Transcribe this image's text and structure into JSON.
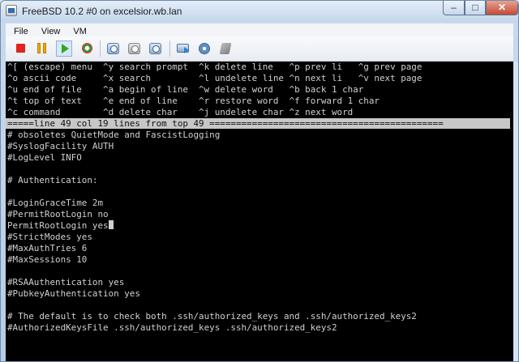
{
  "window": {
    "title": "FreeBSD 10.2 #0 on excelsior.wb.lan",
    "minimize_glyph": "–",
    "maximize_glyph": "□",
    "close_glyph": "✕"
  },
  "menubar": {
    "items": [
      "File",
      "View",
      "VM"
    ]
  },
  "toolbar": {
    "icons": [
      "stop-icon",
      "pause-icon",
      "play-icon",
      "reset-icon",
      "snapshot-icon",
      "revert-snapshot-icon",
      "snapshot-manager-icon",
      "connect-icon",
      "settings-icon",
      "tools-icon"
    ]
  },
  "terminal": {
    "menu_lines": [
      "^[ (escape) menu  ^y search prompt  ^k delete line   ^p prev li   ^g prev page",
      "^o ascii code     ^x search         ^l undelete line ^n next li   ^v next page",
      "^u end of file    ^a begin of line  ^w delete word   ^b back 1 char",
      "^t top of text    ^e end of line    ^r restore word  ^f forward 1 char",
      "^c command        ^d delete char    ^j undelete char ^z next word"
    ],
    "status_line": "=====line 49 col 19 lines from top 49 ============================================",
    "body_lines": [
      "# obsoletes QuietMode and FascistLogging",
      "#SyslogFacility AUTH",
      "#LogLevel INFO",
      "",
      "# Authentication:",
      "",
      "#LoginGraceTime 2m",
      "#PermitRootLogin no",
      "PermitRootLogin yes",
      "#StrictModes yes",
      "#MaxAuthTries 6",
      "#MaxSessions 10",
      "",
      "#RSAAuthentication yes",
      "#PubkeyAuthentication yes",
      "",
      "# The default is to check both .ssh/authorized_keys and .ssh/authorized_keys2",
      "#AuthorizedKeysFile .ssh/authorized_keys .ssh/authorized_keys2"
    ],
    "cursor_line_index": 8
  }
}
